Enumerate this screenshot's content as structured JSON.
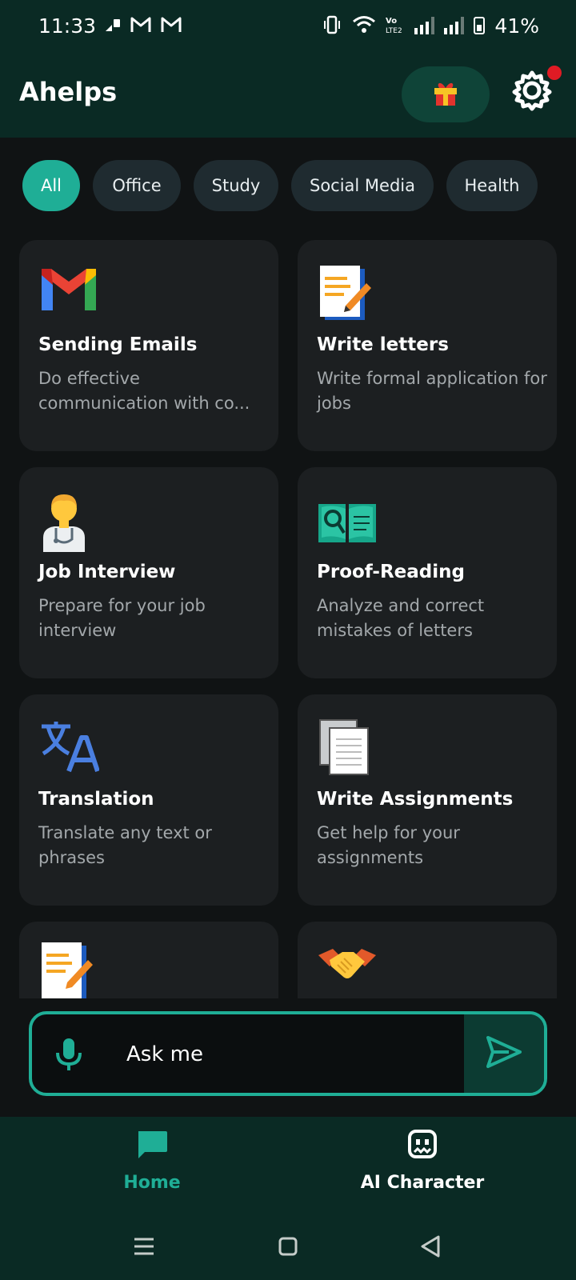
{
  "status_bar": {
    "time": "11:33",
    "battery_percent": "41%",
    "icons": [
      "sim-icon",
      "gmail-icon",
      "gmail-icon",
      "vibrate-icon",
      "wifi-icon",
      "volte-icon",
      "signal-icon",
      "signal-icon",
      "battery-icon"
    ]
  },
  "app_bar": {
    "title": "Ahelps",
    "gift_icon": "gift-icon",
    "settings_icon": "gear-icon",
    "has_notification": true
  },
  "categories": {
    "selected": "All",
    "items": [
      {
        "label": "All"
      },
      {
        "label": "Office"
      },
      {
        "label": "Study"
      },
      {
        "label": "Social Media"
      },
      {
        "label": "Health"
      }
    ]
  },
  "cards": [
    {
      "title": "Sending Emails",
      "desc": "Do effective communication with co...",
      "icon": "gmail-icon"
    },
    {
      "title": "Write letters",
      "desc": "Write formal application for jobs",
      "icon": "memo-icon"
    },
    {
      "title": "Job Interview",
      "desc": "Prepare for your job interview",
      "icon": "health-worker-icon"
    },
    {
      "title": "Proof-Reading",
      "desc": "Analyze and correct mistakes of letters",
      "icon": "open-book-magnifier-icon"
    },
    {
      "title": "Translation",
      "desc": "Translate any text or phrases",
      "icon": "translate-icon"
    },
    {
      "title": "Write Assignments",
      "desc": "Get help for your assignments",
      "icon": "documents-icon"
    },
    {
      "title": "",
      "desc": "",
      "icon": "memo-icon"
    },
    {
      "title": "",
      "desc": "",
      "icon": "handshake-icon"
    }
  ],
  "ask_bar": {
    "placeholder": "Ask me",
    "mic_icon": "mic-icon",
    "send_icon": "send-icon"
  },
  "bottom_nav": {
    "items": [
      {
        "label": "Home",
        "icon": "chat-bubble-icon",
        "active": true
      },
      {
        "label": "AI Character",
        "icon": "robot-icon",
        "active": false
      }
    ]
  },
  "colors": {
    "accent": "#1fae96",
    "app_bar_bg": "#0a2a24",
    "card_bg": "#1c1f21",
    "chip_bg": "#1f2b30",
    "notification": "#e01b24"
  }
}
